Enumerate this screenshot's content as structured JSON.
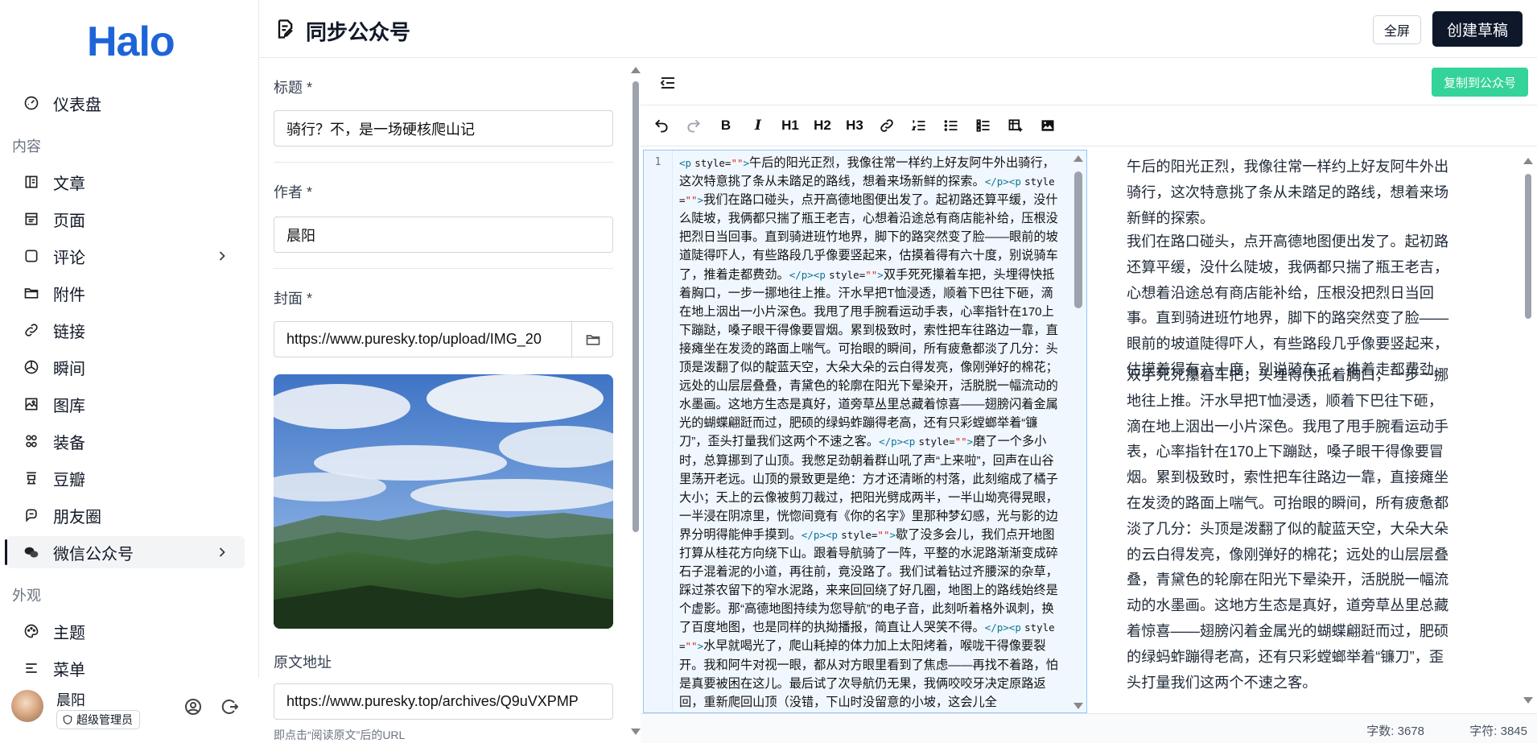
{
  "app": {
    "logo": "Halo"
  },
  "sidebar": {
    "items": [
      {
        "label": "仪表盘",
        "icon": "dashboard-icon"
      },
      {
        "label": "文章",
        "icon": "article-icon"
      },
      {
        "label": "页面",
        "icon": "page-icon"
      },
      {
        "label": "评论",
        "icon": "comment-icon"
      },
      {
        "label": "附件",
        "icon": "folder-icon"
      },
      {
        "label": "链接",
        "icon": "link-icon"
      },
      {
        "label": "瞬间",
        "icon": "moment-icon"
      },
      {
        "label": "图库",
        "icon": "gallery-icon"
      },
      {
        "label": "装备",
        "icon": "equipment-icon"
      },
      {
        "label": "豆瓣",
        "icon": "douban-icon"
      },
      {
        "label": "朋友圈",
        "icon": "friends-icon"
      },
      {
        "label": "微信公众号",
        "icon": "wechat-icon"
      },
      {
        "label": "主题",
        "icon": "palette-icon"
      },
      {
        "label": "菜单",
        "icon": "menu-icon"
      }
    ],
    "sections": {
      "content": "内容",
      "appearance": "外观"
    }
  },
  "user": {
    "name": "晨阳",
    "role": "超级管理员"
  },
  "header": {
    "title": "同步公众号",
    "fullscreen_label": "全屏",
    "create_label": "创建草稿"
  },
  "form": {
    "title_label": "标题 *",
    "title_value": "骑行？不，是一场硬核爬山记",
    "author_label": "作者 *",
    "author_value": "晨阳",
    "cover_label": "封面 *",
    "cover_value": "https://www.puresky.top/upload/IMG_20",
    "source_label": "原文地址",
    "source_value": "https://www.puresky.top/archives/Q9uVXPMP",
    "source_hint": "即点击“阅读原文”后的URL"
  },
  "editor": {
    "copy_label": "复制到公众号",
    "line_number": "1",
    "toolbar": {
      "h1": "H1",
      "h2": "H2",
      "h3": "H3",
      "bold": "B",
      "italic": "I"
    },
    "code": {
      "p1": "午后的阳光正烈，我像往常一样约上好友阿牛外出骑行，这次特意挑了条从未踏足的路线，想着来场新鲜的探索。",
      "p2": "我们在路口碰头，点开高德地图便出发了。起初路还算平缓，没什么陡坡，我俩都只揣了瓶王老吉，心想着沿途总有商店能补给，压根没把烈日当回事。直到骑进班竹地界，脚下的路突然变了脸——眼前的坡道陡得吓人，有些路段几乎像要竖起来，估摸着得有六十度，别说骑车了，推着走都费劲。",
      "p3": "双手死死攥着车把，头埋得快抵着胸口，一步一挪地往上推。汗水早把T恤浸透，顺着下巴往下砸，滴在地上洇出一小片深色。我甩了甩手腕看运动手表，心率指针在170上下蹦跶，嗓子眼干得像要冒烟。累到极致时，索性把车往路边一靠，直接瘫坐在发烫的路面上喘气。可抬眼的瞬间，所有疲惫都淡了几分：头顶是泼翻了似的靛蓝天空，大朵大朵的云白得发亮，像刚弹好的棉花；远处的山层层叠叠，青黛色的轮廓在阳光下晕染开，活脱脱一幅流动的水墨画。这地方生态是真好，道旁草丛里总藏着惊喜——翅膀闪着金属光的蝴蝶翩跹而过，肥硕的绿蚂蚱蹦得老高，还有只彩螳螂举着“镰刀”，歪头打量我们这两个不速之客。",
      "p4": "磨了一个多小时，总算挪到了山顶。我憋足劲朝着群山吼了声“上来啦”，回声在山谷里荡开老远。山顶的景致更是绝：方才还清晰的村落，此刻缩成了橘子大小；天上的云像被剪刀裁过，把阳光劈成两半，一半山坳亮得晃眼，一半浸在阴凉里，恍惚间竟有《你的名字》里那种梦幻感，光与影的边界分明得能伸手摸到。",
      "p5": "歇了没多会儿，我们点开地图打算从桂花方向绕下山。跟着导航骑了一阵，平整的水泥路渐渐变成碎石子混着泥的小道，再往前，竟没路了。我们试着钻过齐腰深的杂草，踩过茶农留下的窄水泥路，来来回回绕了好几圈，地图上的路线始终是个虚影。那“高德地图持续为您导航”的电子音，此刻听着格外讽刺，换了百度地图，也是同样的执拗播报，简直让人哭笑不得。",
      "p6": "水早就喝光了，爬山耗掉的体力加上太阳烤着，喉咙干得像要裂开。我和阿牛对视一眼，都从对方眼里看到了焦虑——再找不着路，怕是真要被困在这儿。最后试了次导航仍无果，我俩咬咬牙决定原路返回，重新爬回山顶（没错，下山时没留意的小坡，这会儿全"
    },
    "preview": {
      "p1": "午后的阳光正烈，我像往常一样约上好友阿牛外出骑行，这次特意挑了条从未踏足的路线，想着来场新鲜的探索。",
      "p2": "我们在路口碰头，点开高德地图便出发了。起初路还算平缓，没什么陡坡，我俩都只揣了瓶王老吉，心想着沿途总有商店能补给，压根没把烈日当回事。直到骑进班竹地界，脚下的路突然变了脸——眼前的坡道陡得吓人，有些路段几乎像要竖起来，估摸着得有六十度，别说骑车了，推着走都费劲。",
      "p3": "双手死死攥着车把，头埋得快抵着胸口，一步一挪地往上推。汗水早把T恤浸透，顺着下巴往下砸，滴在地上洇出一小片深色。我甩了甩手腕看运动手表，心率指针在170上下蹦跶，嗓子眼干得像要冒烟。累到极致时，索性把车往路边一靠，直接瘫坐在发烫的路面上喘气。可抬眼的瞬间，所有疲惫都淡了几分：头顶是泼翻了似的靛蓝天空，大朵大朵的云白得发亮，像刚弹好的棉花；远处的山层层叠叠，青黛色的轮廓在阳光下晕染开，活脱脱一幅流动的水墨画。这地方生态是真好，道旁草丛里总藏着惊喜——翅膀闪着金属光的蝴蝶翩跹而过，肥硕的绿蚂蚱蹦得老高，还有只彩螳螂举着“镰刀”，歪头打量我们这两个不速之客。"
    }
  },
  "status": {
    "words": "字数: 3678",
    "chars": "字符: 3845"
  }
}
